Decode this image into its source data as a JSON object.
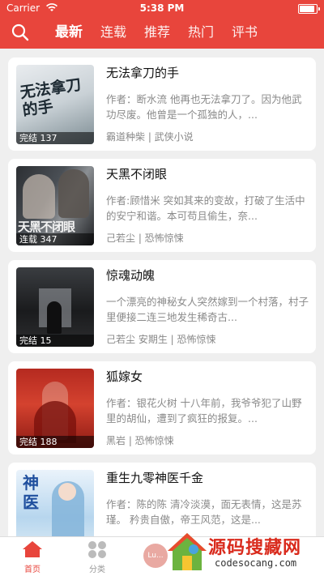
{
  "status_bar": {
    "carrier": "Carrier",
    "time": "5:38 PM",
    "battery_level": 1.0
  },
  "nav": {
    "tabs": [
      {
        "label": "最新",
        "active": true
      },
      {
        "label": "连载",
        "active": false
      },
      {
        "label": "推荐",
        "active": false
      },
      {
        "label": "热门",
        "active": false
      },
      {
        "label": "评书",
        "active": false
      }
    ]
  },
  "books": [
    {
      "title": "无法拿刀的手",
      "desc": "作者：断水流 他再也无法拿刀了。因为他武功尽废。他曾是一个孤独的人，...",
      "meta": "霸道种柴 | 武侠小说",
      "badge": "完结 137",
      "cover_text": "无法拿刀的手"
    },
    {
      "title": "天黑不闭眼",
      "desc": "作者:顾惜米 突如其来的变故，打破了生活中的安宁和谐。本可苟且偷生，奈...",
      "meta": "己若尘 | 恐怖惊悚",
      "badge": "连载 347",
      "cover_text": "天黑不闭眼"
    },
    {
      "title": "惊魂动魄",
      "desc": "一个漂亮的神秘女人突然嫁到一个村落，村子里便接二连三地发生稀奇古...",
      "meta": "己若尘 安期生 | 恐怖惊悚",
      "badge": "完结 15",
      "cover_text": ""
    },
    {
      "title": "狐嫁女",
      "desc": "作者：银花火树 十八年前，我爷爷犯了山野里的胡仙，遭到了疯狂的报复。...",
      "meta": "黑岩 | 恐怖惊悚",
      "badge": "完结 188",
      "cover_text": ""
    },
    {
      "title": "重生九零神医千金",
      "desc": "作者：陈的陈 清冷淡漠，面无表情，这是苏瑾。 矜贵自傲，帝王风范，这是...",
      "meta": "",
      "badge": "",
      "cover_text": "神医"
    }
  ],
  "tabbar": {
    "home": "首页",
    "category": "分类",
    "center": "Lu..."
  },
  "watermark": {
    "text": "源码搜藏网",
    "url": "codesocang.com"
  },
  "colors": {
    "primary": "#e8453c"
  }
}
